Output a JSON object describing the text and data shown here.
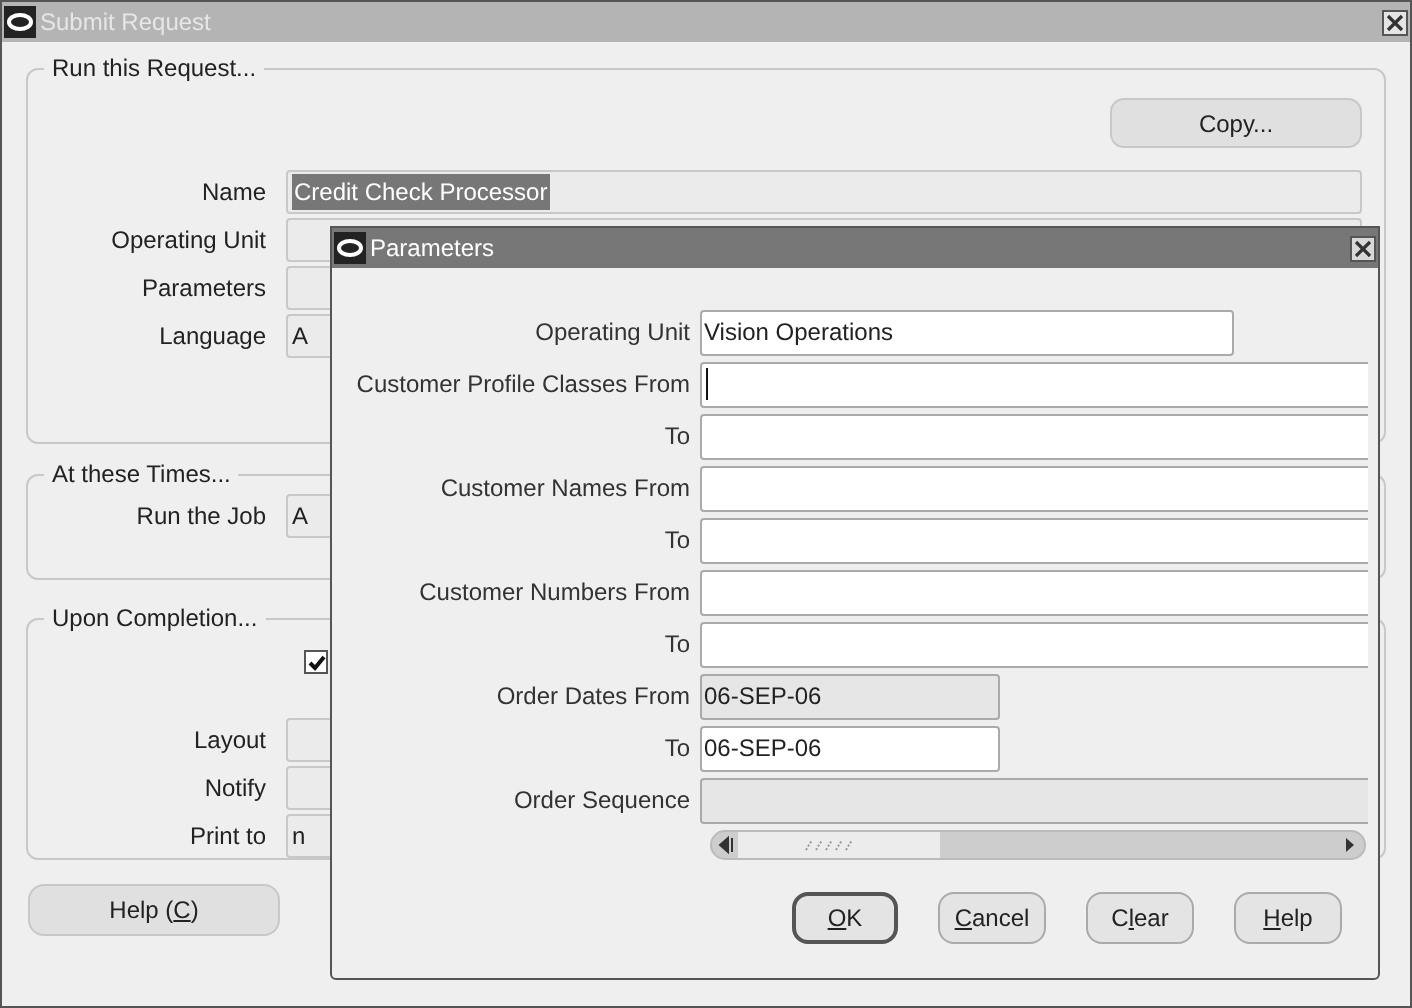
{
  "window": {
    "title": "Submit Request",
    "active": false
  },
  "run_request": {
    "legend": "Run this Request...",
    "copy_button": "Copy...",
    "fields": [
      {
        "label": "Name",
        "value": "Credit Check Processor",
        "value_selected": true
      },
      {
        "label": "Operating Unit"
      },
      {
        "label": "Parameters"
      },
      {
        "label": "Language",
        "value": "A"
      }
    ]
  },
  "times": {
    "legend": "At these Times...",
    "fields": [
      {
        "label": "Run the Job",
        "value": "A"
      }
    ]
  },
  "completion": {
    "legend": "Upon Completion...",
    "checkbox": {
      "checked": true
    },
    "fields": [
      {
        "label": "Layout"
      },
      {
        "label": "Notify"
      },
      {
        "label": "Print to",
        "value": "n"
      }
    ]
  },
  "help_button": {
    "before": "Help (",
    "key": "C",
    "after": ")"
  },
  "dialog": {
    "title": "Parameters",
    "active": true,
    "fields": [
      {
        "label": "Operating Unit",
        "value": "Vision Operations",
        "kind": "medium",
        "disabled": false,
        "focused": false
      },
      {
        "label": "Customer Profile Classes From",
        "kind": "wide",
        "disabled": false,
        "focused": true
      },
      {
        "label": "To",
        "kind": "wide",
        "disabled": false,
        "focused": false
      },
      {
        "label": "Customer Names From",
        "kind": "wide",
        "disabled": false,
        "focused": false
      },
      {
        "label": "To",
        "kind": "wide",
        "disabled": false,
        "focused": false
      },
      {
        "label": "Customer Numbers From",
        "kind": "wide",
        "disabled": false,
        "focused": false
      },
      {
        "label": "To",
        "kind": "wide",
        "disabled": false,
        "focused": false
      },
      {
        "label": "Order Dates From",
        "value": "06-SEP-06",
        "kind": "short",
        "disabled": true,
        "focused": false
      },
      {
        "label": "To",
        "value": "06-SEP-06",
        "kind": "short",
        "disabled": false,
        "focused": false
      },
      {
        "label": "Order Sequence",
        "kind": "wide",
        "disabled": true,
        "focused": false
      }
    ],
    "buttons": [
      {
        "key": "O",
        "after": "K",
        "default": true
      },
      {
        "key": "C",
        "after": "ancel",
        "default": false
      },
      {
        "before": "C",
        "key": "l",
        "after": "ear",
        "default": false
      },
      {
        "key": "H",
        "after": "elp",
        "default": false
      }
    ]
  }
}
